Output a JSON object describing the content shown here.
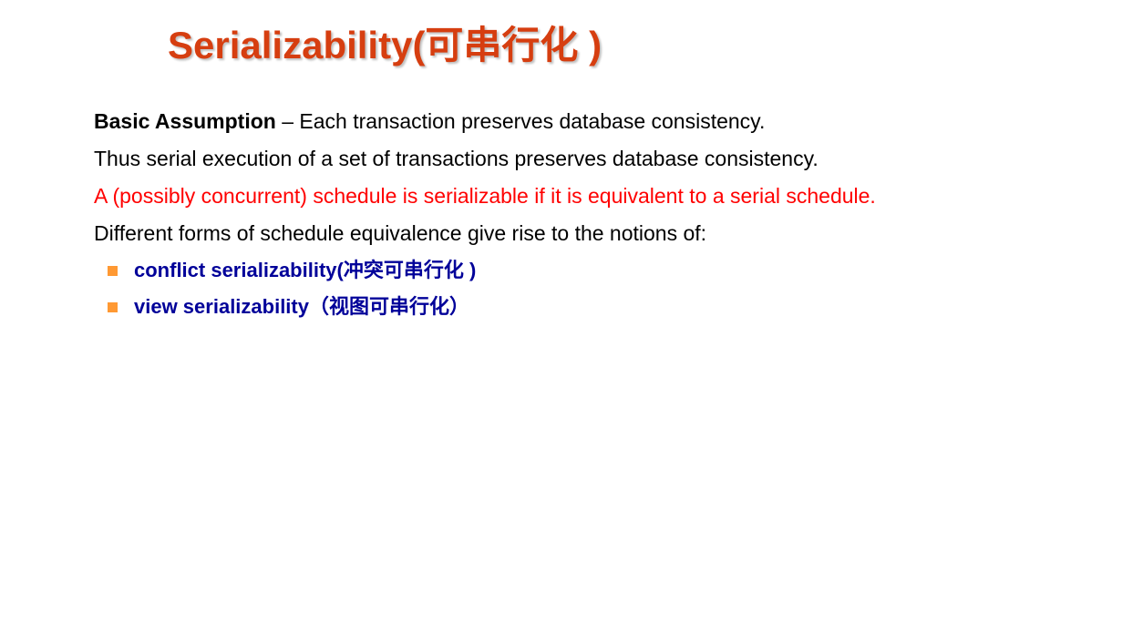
{
  "title": "Serializability(可串行化 )",
  "paragraphs": {
    "assumption_bold": "Basic Assumption",
    "assumption_rest": " – Each transaction preserves database consistency.",
    "serial": "Thus serial execution of a set of transactions preserves database consistency.",
    "definition": "A (possibly concurrent) schedule is serializable if it is equivalent to a serial schedule.",
    "forms": "Different forms of schedule equivalence give rise to the notions of:"
  },
  "bullets": [
    "conflict serializability(冲突可串行化 )",
    "view serializability（视图可串行化）"
  ],
  "colors": {
    "title": "#d63e10",
    "definition": "#ff0000",
    "bullet_text": "#000099",
    "bullet_marker": "#ff9933"
  }
}
